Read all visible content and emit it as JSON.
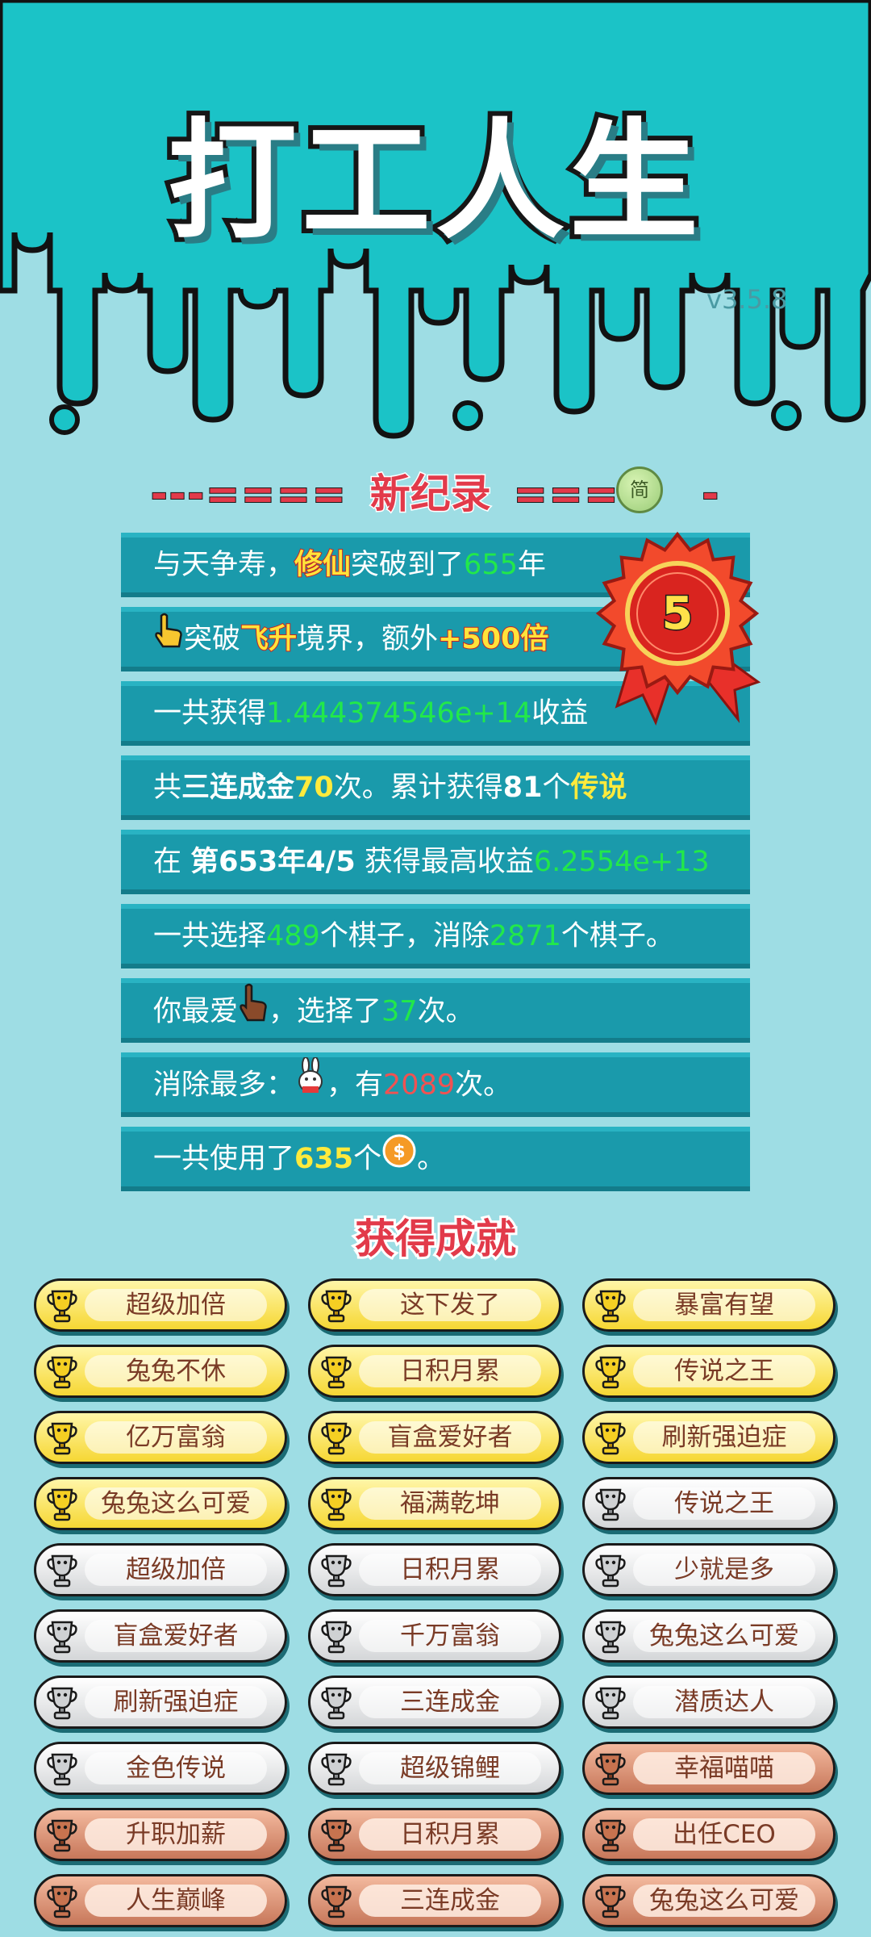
{
  "app": {
    "title": "打工人生",
    "version": "v3.5.8"
  },
  "record": {
    "dashes_left": "---====",
    "title": "新纪录",
    "dashes_right": "====",
    "dash_end": "-",
    "badge": "简",
    "medal_number": "5"
  },
  "stats": [
    {
      "parts": [
        "与天争寿，",
        "修仙",
        "突破到了",
        "655",
        "年"
      ]
    },
    {
      "parts": [
        "突破",
        "飞升",
        "境界，额外",
        "+500倍"
      ]
    },
    {
      "parts": [
        "一共获得",
        "1.444374546e+14",
        "收益"
      ]
    },
    {
      "parts": [
        "共",
        "三连成金",
        "70",
        "次。累计获得",
        "81",
        "个",
        "传说"
      ]
    },
    {
      "parts": [
        "在 ",
        "第653年4/5",
        " 获得最高收益",
        "6.2554e+13"
      ]
    },
    {
      "parts": [
        "一共选择",
        "489",
        "个棋子，消除",
        "2871",
        "个棋子。"
      ]
    },
    {
      "parts": [
        "你最爱",
        "，选择了",
        "37",
        "次。"
      ]
    },
    {
      "parts": [
        "消除最多：",
        "，有",
        "2089",
        "次。"
      ]
    },
    {
      "parts": [
        "一共使用了",
        "635",
        "个",
        "。"
      ]
    }
  ],
  "achievements_title": "获得成就",
  "achievements": [
    {
      "label": "超级加倍",
      "tier": "gold"
    },
    {
      "label": "这下发了",
      "tier": "gold"
    },
    {
      "label": "暴富有望",
      "tier": "gold"
    },
    {
      "label": "兔兔不休",
      "tier": "gold"
    },
    {
      "label": "日积月累",
      "tier": "gold"
    },
    {
      "label": "传说之王",
      "tier": "gold"
    },
    {
      "label": "亿万富翁",
      "tier": "gold"
    },
    {
      "label": "盲盒爱好者",
      "tier": "gold"
    },
    {
      "label": "刷新强迫症",
      "tier": "gold"
    },
    {
      "label": "兔兔这么可爱",
      "tier": "gold"
    },
    {
      "label": "福满乾坤",
      "tier": "gold"
    },
    {
      "label": "传说之王",
      "tier": "silver"
    },
    {
      "label": "超级加倍",
      "tier": "silver"
    },
    {
      "label": "日积月累",
      "tier": "silver"
    },
    {
      "label": "少就是多",
      "tier": "silver"
    },
    {
      "label": "盲盒爱好者",
      "tier": "silver"
    },
    {
      "label": "千万富翁",
      "tier": "silver"
    },
    {
      "label": "兔兔这么可爱",
      "tier": "silver"
    },
    {
      "label": "刷新强迫症",
      "tier": "silver"
    },
    {
      "label": "三连成金",
      "tier": "silver"
    },
    {
      "label": "潜质达人",
      "tier": "silver"
    },
    {
      "label": "金色传说",
      "tier": "silver"
    },
    {
      "label": "超级锦鲤",
      "tier": "silver"
    },
    {
      "label": "幸福喵喵",
      "tier": "bronze"
    },
    {
      "label": "升职加薪",
      "tier": "bronze"
    },
    {
      "label": "日积月累",
      "tier": "bronze"
    },
    {
      "label": "出任CEO",
      "tier": "bronze"
    },
    {
      "label": "人生巅峰",
      "tier": "bronze"
    },
    {
      "label": "三连成金",
      "tier": "bronze"
    },
    {
      "label": "兔兔这么可爱",
      "tier": "bronze"
    }
  ],
  "icons": {
    "pointing_hand_gold": "pointing-hand-icon",
    "pointing_hand_brown": "brown-hand-icon",
    "rabbit": "rabbit-icon",
    "coin": "coin-icon",
    "trophy": "trophy-icon",
    "medal": "rosette-medal-icon"
  },
  "colors": {
    "header_bg": "#1bc3c7",
    "page_bg": "#9edde4",
    "stat_row_bg": "#1a9aab",
    "highlight_green": "#22e84a",
    "highlight_yellow": "#ffea3c",
    "accent_red": "#e23a4a",
    "pill_gold": "#f6d733",
    "pill_silver": "#d4d6d8",
    "pill_bronze": "#c7775a"
  }
}
